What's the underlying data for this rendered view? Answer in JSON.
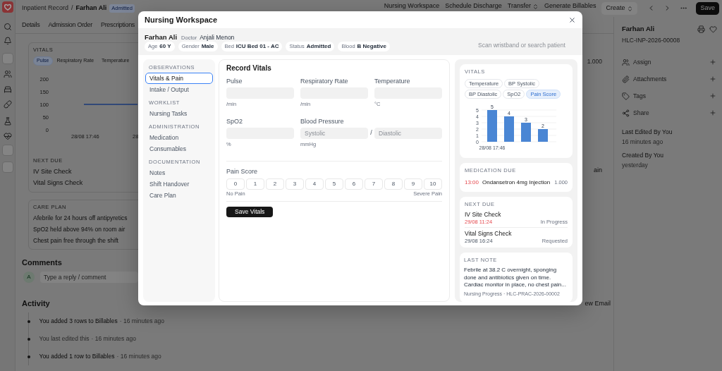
{
  "page": {
    "breadcrumb": {
      "parent": "Inpatient Record",
      "separator": "/",
      "current": "Farhan Ali",
      "status": "Admitted"
    },
    "actions": [
      {
        "label": "Nursing Workspace",
        "kind": "ghost",
        "dropdown": false
      },
      {
        "label": "Schedule Discharge",
        "kind": "ghost",
        "dropdown": false
      },
      {
        "label": "Transfer",
        "kind": "ghost",
        "dropdown": true
      },
      {
        "label": "Generate Billables",
        "kind": "ghost",
        "dropdown": false
      },
      {
        "label": "Create",
        "kind": "secondary",
        "dropdown": true
      },
      {
        "label": "Save",
        "kind": "primary",
        "dropdown": false
      }
    ],
    "tabs": [
      "Details",
      "Admission Order",
      "Prescriptions"
    ],
    "vitals": {
      "title": "VITALS",
      "chips": [
        {
          "label": "Pulse",
          "selected": true
        },
        {
          "label": "Respiratory Rate",
          "selected": false
        },
        {
          "label": "Temperature",
          "selected": false
        }
      ],
      "chart_data": {
        "type": "line",
        "categories": [
          "28/08 17:46",
          "28"
        ],
        "values": [
          100,
          100
        ],
        "yticks": [
          0,
          50,
          100,
          150,
          200
        ],
        "ylim": [
          0,
          200
        ]
      },
      "quantity": "1.000"
    },
    "next_due": {
      "title": "NEXT DUE",
      "items": [
        "IV Site Check",
        "Vital Signs Check"
      ],
      "cut_text": "ain"
    },
    "care_plan": {
      "title": "CARE PLAN",
      "items": [
        "Afebrile for 24 hours off antipyretics",
        "SpO2 held above 94% on room air",
        "Chest pain free through the shift"
      ]
    },
    "comments": {
      "title": "Comments",
      "avatar": "A",
      "placeholder": "Type a reply / comment"
    },
    "activity": {
      "title": "Activity",
      "cut_link": "ew Email",
      "items": [
        {
          "text": "You added 3 rows to Billables",
          "time": "· 16 minutes ago",
          "emphasis": true
        },
        {
          "text": "You last edited this",
          "time": "· 16 minutes ago",
          "emphasis": false
        },
        {
          "text": "You added 1 row to Billables",
          "time": "· 16 minutes ago",
          "emphasis": true
        }
      ]
    },
    "sidebar": {
      "name": "Farhan Ali",
      "record_id": "HLC-INP-2026-00008",
      "actions": [
        "Assign",
        "Attachments",
        "Tags",
        "Share"
      ],
      "meta": [
        {
          "label": "Last Edited By You",
          "value": "16 minutes ago"
        },
        {
          "label": "Created By You",
          "value": "yesterday"
        }
      ]
    }
  },
  "modal": {
    "title": "Nursing Workspace",
    "patient": {
      "name": "Farhan Ali",
      "doctor_label": "Doctor",
      "doctor": "Anjali Menon",
      "chips": [
        {
          "label": "Age",
          "value": "60 Y"
        },
        {
          "label": "Gender",
          "value": "Male"
        },
        {
          "label": "Bed",
          "value": "ICU Bed 01 - AC"
        },
        {
          "label": "Status",
          "value": "Admitted"
        },
        {
          "label": "Blood",
          "value": "B Negative"
        }
      ]
    },
    "search": {
      "placeholder": "Scan wristband or search patient"
    },
    "nav": [
      {
        "heading": "OBSERVATIONS",
        "items": [
          {
            "label": "Vitals & Pain",
            "selected": true
          },
          {
            "label": "Intake / Output",
            "selected": false
          }
        ]
      },
      {
        "heading": "WORKLIST",
        "items": [
          {
            "label": "Nursing Tasks",
            "selected": false
          }
        ]
      },
      {
        "heading": "ADMINISTRATION",
        "items": [
          {
            "label": "Medication",
            "selected": false
          },
          {
            "label": "Consumables",
            "selected": false
          }
        ]
      },
      {
        "heading": "DOCUMENTATION",
        "items": [
          {
            "label": "Notes",
            "selected": false
          },
          {
            "label": "Shift Handover",
            "selected": false
          },
          {
            "label": "Care Plan",
            "selected": false
          }
        ]
      }
    ],
    "form": {
      "title": "Record Vitals",
      "fields": [
        {
          "kind": "single",
          "label": "Pulse",
          "unit": "/min"
        },
        {
          "kind": "single",
          "label": "Respiratory Rate",
          "unit": "/min"
        },
        {
          "kind": "single",
          "label": "Temperature",
          "unit": "°C"
        },
        {
          "kind": "single",
          "label": "SpO2",
          "unit": "%"
        },
        {
          "kind": "pair",
          "label": "Blood Pressure",
          "placeholders": [
            "Systolic",
            "Diastolic"
          ],
          "separator": "/",
          "unit": "mmHg"
        }
      ],
      "pain_score": {
        "label": "Pain Score",
        "options": [
          {
            "label": "0",
            "selected": false
          },
          {
            "label": "1",
            "selected": false
          },
          {
            "label": "2",
            "selected": false
          },
          {
            "label": "3",
            "selected": false
          },
          {
            "label": "4",
            "selected": false
          },
          {
            "label": "5",
            "selected": false
          },
          {
            "label": "6",
            "selected": false
          },
          {
            "label": "7",
            "selected": false
          },
          {
            "label": "8",
            "selected": false
          },
          {
            "label": "9",
            "selected": false
          },
          {
            "label": "10",
            "selected": false
          }
        ],
        "min_label": "No Pain",
        "max_label": "Severe Pain"
      },
      "submit": "Save Vitals"
    },
    "side": {
      "vitals": {
        "title": "VITALS",
        "chips": [
          {
            "label": "Temperature",
            "selected": false
          },
          {
            "label": "BP Systolic",
            "selected": false
          },
          {
            "label": "BP Diastolic",
            "selected": false
          },
          {
            "label": "SpO2",
            "selected": false
          },
          {
            "label": "Pain Score",
            "selected": true
          }
        ],
        "chart_data": {
          "type": "bar",
          "categories": [
            "28/08 17:46",
            null,
            null,
            null
          ],
          "values": [
            5,
            4,
            3,
            2
          ],
          "yticks": [
            0,
            1,
            2,
            3,
            4,
            5
          ],
          "ylim": [
            0,
            5
          ],
          "grid": true,
          "data_labels": true
        }
      },
      "medication_due": {
        "title": "MEDICATION DUE",
        "items": [
          {
            "time": "13:00",
            "name": "Ondansetron 4mg Injection",
            "quantity": "1.000",
            "overdue": true
          }
        ]
      },
      "next_due": {
        "title": "NEXT DUE",
        "items": [
          {
            "name": "IV Site Check",
            "due": "29/08 11:24",
            "status": "In Progress",
            "overdue": true
          },
          {
            "name": "Vital Signs Check",
            "due": "29/08 16:24",
            "status": "Requested",
            "overdue": false
          }
        ]
      },
      "last_note": {
        "title": "LAST NOTE",
        "text": "Febrile at 38.2 C overnight, sponging done and antibiotics given on time. Cardiac monitor in place, no chest pain...",
        "source": "Nursing Progress · HLC-PRAC-2026-00002"
      }
    }
  }
}
